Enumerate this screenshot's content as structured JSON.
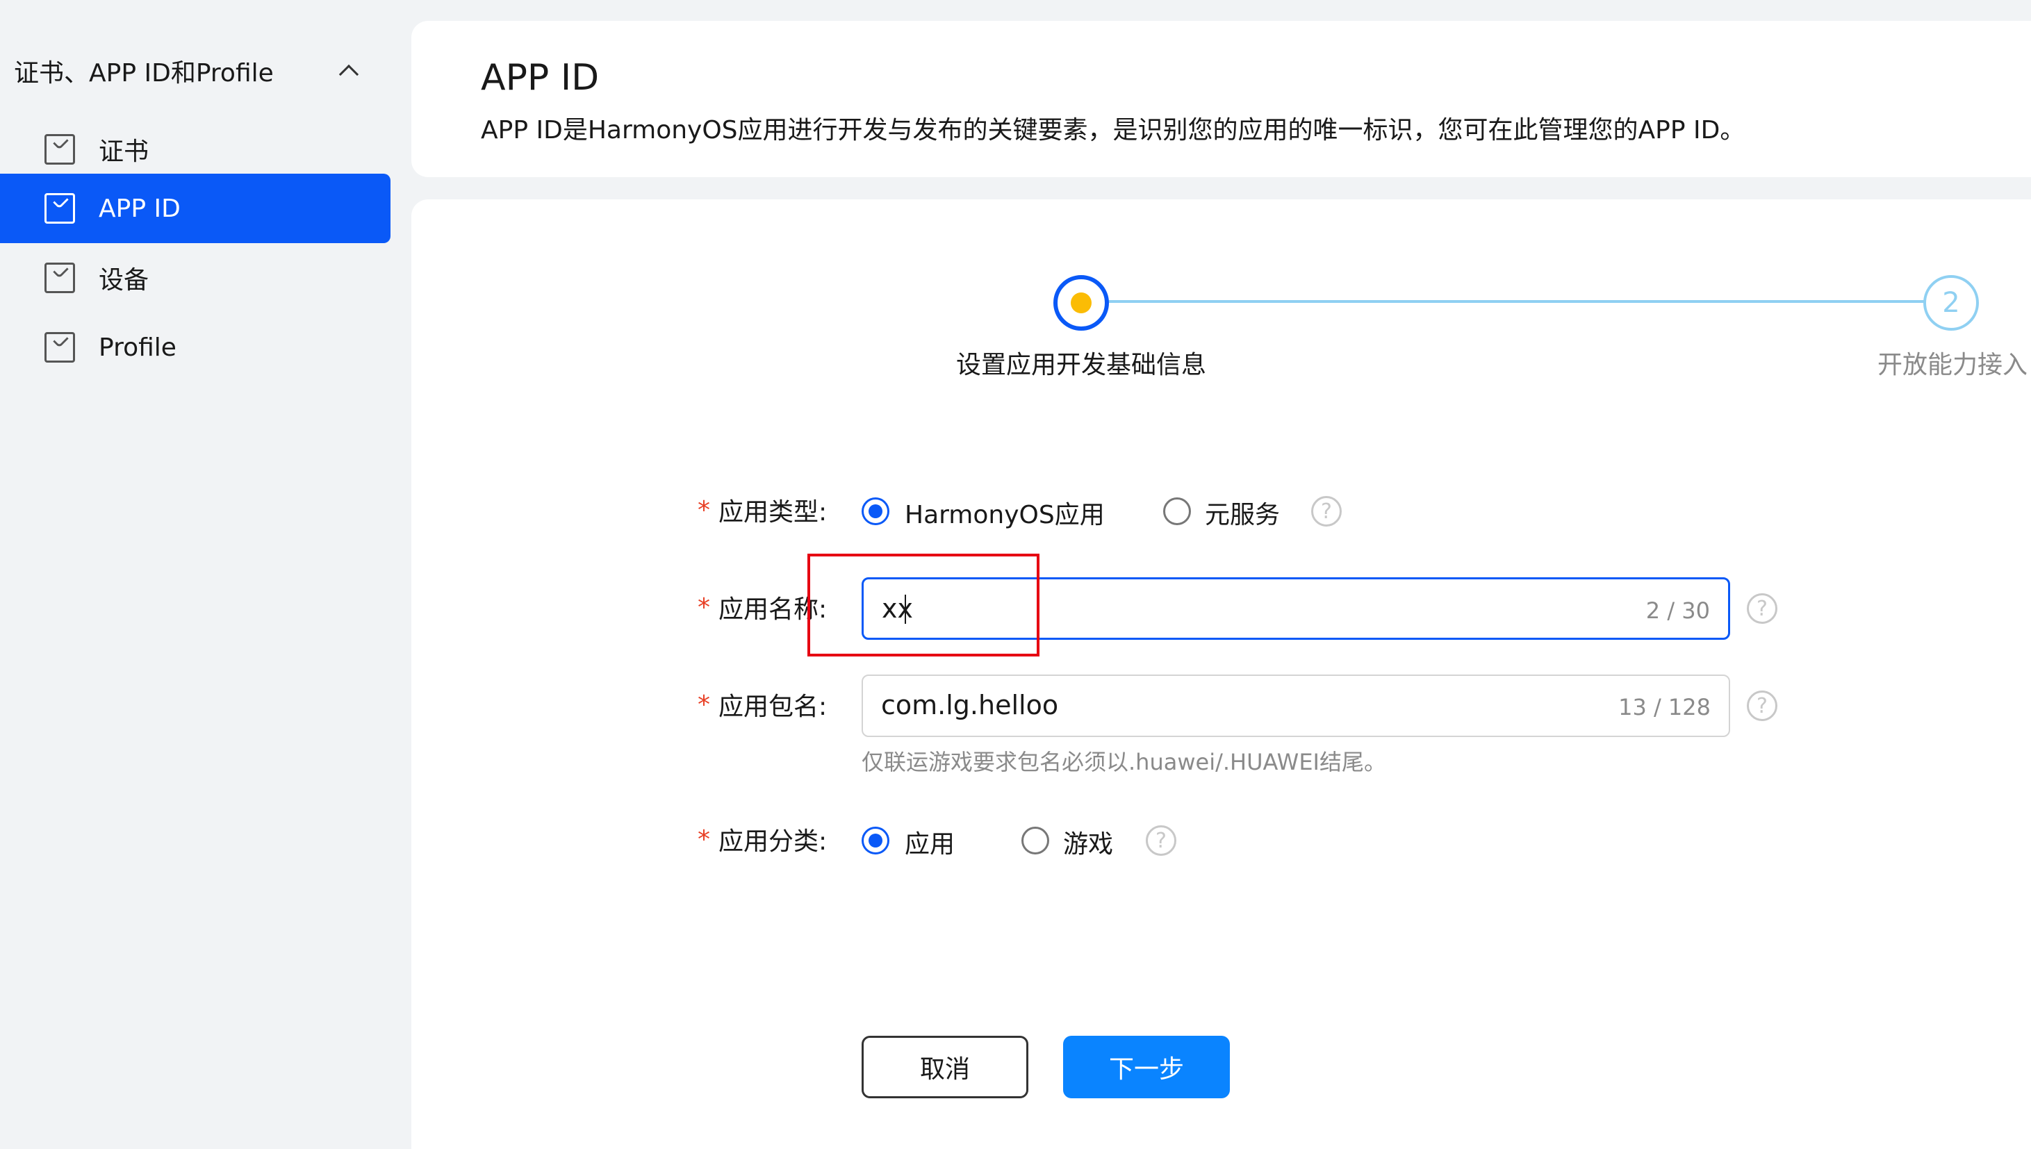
{
  "sidebar": {
    "group_label": "证书、APP ID和Profile",
    "items": [
      {
        "label": "证书",
        "active": false
      },
      {
        "label": "APP ID",
        "active": true
      },
      {
        "label": "设备",
        "active": false
      },
      {
        "label": "Profile",
        "active": false
      }
    ]
  },
  "header": {
    "title": "APP ID",
    "description": "APP ID是HarmonyOS应用进行开发与发布的关键要素，是识别您的应用的唯一标识，您可在此管理您的APP ID。"
  },
  "stepper": {
    "steps": [
      {
        "number": "1",
        "label": "设置应用开发基础信息",
        "state": "current"
      },
      {
        "number": "2",
        "label": "开放能力接入",
        "state": "pending"
      }
    ]
  },
  "form": {
    "required_mark": "*",
    "app_type": {
      "label": "应用类型:",
      "options": [
        {
          "label": "HarmonyOS应用",
          "selected": true
        },
        {
          "label": "元服务",
          "selected": false
        }
      ]
    },
    "app_name": {
      "label": "应用名称:",
      "value": "xx",
      "counter": "2 / 30"
    },
    "package_name": {
      "label": "应用包名:",
      "value": "com.lg.helloo",
      "counter": "13 / 128",
      "hint": "仅联运游戏要求包名必须以.huawei/.HUAWEI结尾。"
    },
    "app_category": {
      "label": "应用分类:",
      "options": [
        {
          "label": "应用",
          "selected": true
        },
        {
          "label": "游戏",
          "selected": false
        }
      ]
    },
    "help_glyph": "?"
  },
  "buttons": {
    "cancel": "取消",
    "next": "下一步"
  },
  "colors": {
    "primary": "#0a59f7",
    "next_button": "#0a84ff",
    "step_pending": "#8fd0f2",
    "step_dot": "#fbbc05",
    "annotation_red": "#e60012",
    "required": "#e84026"
  }
}
